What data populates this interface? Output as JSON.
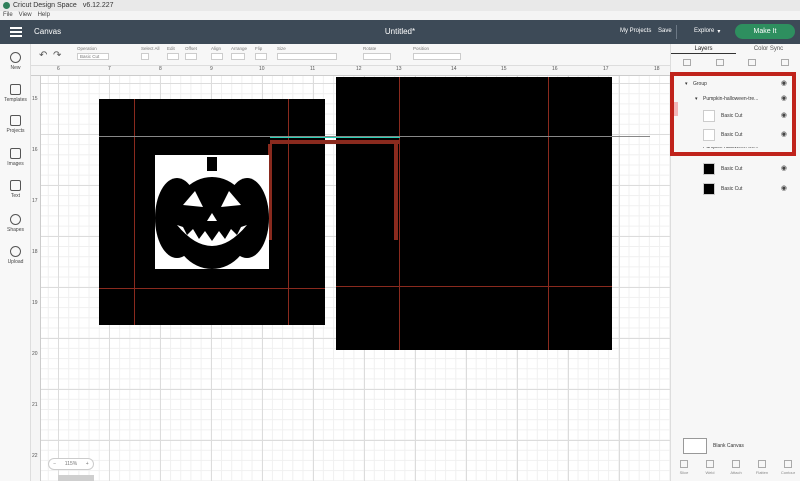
{
  "titlebar": {
    "app_name": "Cricut Design Space",
    "version": "v6.12.227"
  },
  "menubar": {
    "items": [
      "File",
      "View",
      "Help"
    ]
  },
  "header": {
    "canvas_label": "Canvas",
    "doc_title": "Untitled*",
    "my_projects": "My Projects",
    "save": "Save",
    "explore": "Explore",
    "make_it": "Make It"
  },
  "leftbar": {
    "items": [
      {
        "label": "New",
        "icon": "plus-icon"
      },
      {
        "label": "Templates",
        "icon": "shirt-icon"
      },
      {
        "label": "Projects",
        "icon": "grid-icon"
      },
      {
        "label": "Images",
        "icon": "image-icon"
      },
      {
        "label": "Text",
        "icon": "text-icon"
      },
      {
        "label": "Shapes",
        "icon": "shapes-icon"
      },
      {
        "label": "Upload",
        "icon": "upload-icon"
      }
    ]
  },
  "edit_bar": {
    "controls": [
      {
        "label": "Operation",
        "value": "Basic Cut"
      },
      {
        "label": "Select All",
        "value": ""
      },
      {
        "label": "Edit",
        "value": ""
      },
      {
        "label": "Offset",
        "value": ""
      },
      {
        "label": "Align",
        "value": ""
      },
      {
        "label": "Arrange",
        "value": ""
      },
      {
        "label": "Flip",
        "value": ""
      },
      {
        "label": "Size",
        "value": ""
      },
      {
        "label": "Rotate",
        "value": ""
      },
      {
        "label": "Position",
        "value": ""
      }
    ]
  },
  "ruler": {
    "top": [
      "6",
      "7",
      "8",
      "9",
      "10",
      "11",
      "12",
      "13",
      "14",
      "15",
      "16",
      "17",
      "18"
    ],
    "left": [
      "15",
      "16",
      "17",
      "18",
      "19",
      "20",
      "21",
      "22"
    ]
  },
  "zoom": {
    "value": "115%",
    "minus": "−",
    "plus": "+"
  },
  "right_panel": {
    "tabs": [
      "Layers",
      "Color Sync"
    ],
    "tools": [
      "Group",
      "Ungroup",
      "Duplicate",
      "Delete"
    ],
    "layers": [
      {
        "label": "Group",
        "caret": "▾"
      },
      {
        "label": "Pumpkin-halloween-tre...",
        "caret": "▾"
      },
      {
        "label": "Basic Cut"
      },
      {
        "label": "Basic Cut"
      },
      {
        "label": "Pumpkin-halloween-tre..."
      },
      {
        "label": "Basic Cut"
      },
      {
        "label": "Basic Cut"
      }
    ],
    "blank_canvas": "Blank Canvas",
    "bottom_tools": [
      "Slice",
      "Weld",
      "Attach",
      "Flatten",
      "Contour"
    ]
  },
  "colors": {
    "header": "#3d4a57",
    "make_it": "#2e8f5f",
    "highlight": "#c0231c"
  }
}
